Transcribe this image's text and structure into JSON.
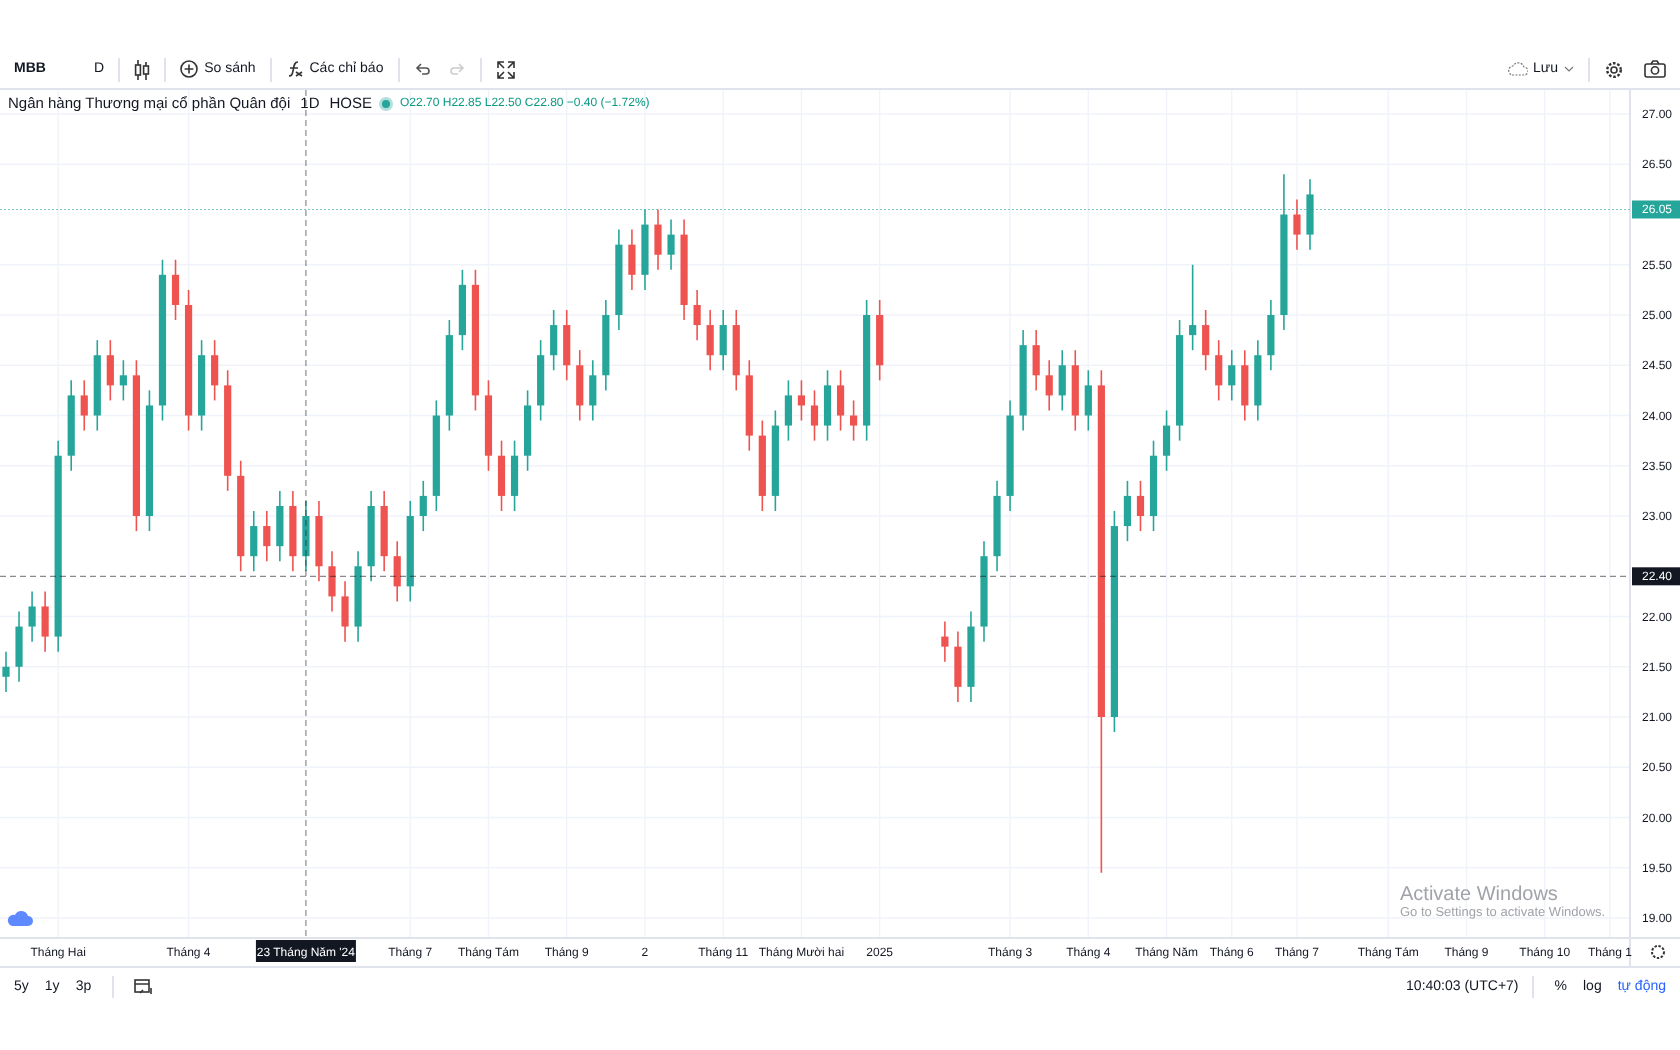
{
  "toolbar": {
    "symbol": "MBB",
    "interval": "D",
    "compare": "So sánh",
    "indicators": "Các chỉ báo",
    "save": "Lưu"
  },
  "legend": {
    "name": "Ngân hàng Thương mại cổ phần Quân đội",
    "interval": "1D",
    "exchange": "HOSE",
    "ohlc": "O22.70 H22.85 L22.50 C22.80 −0.40 (−1.72%)"
  },
  "chart_data": {
    "type": "candlestick",
    "grid": true,
    "ylim": [
      18.801,
      27.239
    ],
    "yticks": [
      {
        "value": 19,
        "label": "19.00"
      },
      {
        "value": 19.5,
        "label": "19.50"
      },
      {
        "value": 20,
        "label": "20.00"
      },
      {
        "value": 20.5,
        "label": "20.50"
      },
      {
        "value": 21,
        "label": "21.00"
      },
      {
        "value": 21.5,
        "label": "21.50"
      },
      {
        "value": 22,
        "label": "22.00"
      },
      {
        "value": 23,
        "label": "23.00"
      },
      {
        "value": 23.5,
        "label": "23.50"
      },
      {
        "value": 24,
        "label": "24.00"
      },
      {
        "value": 24.5,
        "label": "24.50"
      },
      {
        "value": 25,
        "label": "25.00"
      },
      {
        "value": 25.5,
        "label": "25.50"
      },
      {
        "value": 26.5,
        "label": "26.50"
      },
      {
        "value": 27,
        "label": "27.00"
      }
    ],
    "categories": [
      null,
      null,
      null,
      null,
      "Tháng Hai",
      null,
      null,
      null,
      null,
      null,
      null,
      null,
      null,
      null,
      "Tháng 4",
      null,
      null,
      null,
      null,
      null,
      null,
      null,
      null,
      null,
      null,
      null,
      null,
      null,
      null,
      null,
      null,
      "Tháng 7",
      null,
      null,
      null,
      null,
      null,
      "Tháng Tám",
      null,
      null,
      null,
      null,
      null,
      "Tháng 9",
      null,
      null,
      null,
      null,
      null,
      "2",
      null,
      null,
      null,
      null,
      null,
      "Tháng 11",
      null,
      null,
      null,
      null,
      null,
      "Tháng Mười hai",
      null,
      null,
      null,
      null,
      null,
      "2025",
      null,
      null,
      null,
      null,
      null,
      null,
      null,
      null,
      null,
      "Tháng 3",
      null,
      null,
      null,
      null,
      null,
      "Tháng 4",
      null,
      null,
      null,
      null,
      null,
      "Tháng Năm",
      null,
      null,
      null,
      null,
      "Tháng 6",
      null,
      null,
      null,
      null,
      "Tháng 7",
      null,
      null,
      null,
      null,
      null,
      null,
      "Tháng Tám",
      null,
      null,
      null,
      null,
      null,
      "Tháng 9",
      null,
      null,
      null,
      null,
      null,
      "Tháng 10",
      null,
      null,
      null,
      null,
      "Tháng 1",
      null,
      null
    ],
    "ohlc": [
      [
        21.4,
        21.65,
        21.25,
        21.5
      ],
      [
        21.5,
        22.05,
        21.35,
        21.9
      ],
      [
        21.9,
        22.25,
        21.75,
        22.1
      ],
      [
        22.1,
        22.25,
        21.65,
        21.8
      ],
      [
        21.8,
        23.75,
        21.65,
        23.6
      ],
      [
        23.6,
        24.35,
        23.45,
        24.2
      ],
      [
        24.2,
        24.35,
        23.85,
        24.0
      ],
      [
        24.0,
        24.75,
        23.85,
        24.6
      ],
      [
        24.6,
        24.75,
        24.15,
        24.3
      ],
      [
        24.3,
        24.55,
        24.15,
        24.4
      ],
      [
        24.4,
        24.55,
        22.85,
        23.0
      ],
      [
        23.0,
        24.25,
        22.85,
        24.1
      ],
      [
        24.1,
        25.55,
        23.95,
        25.4
      ],
      [
        25.4,
        25.55,
        24.95,
        25.1
      ],
      [
        25.1,
        25.25,
        23.85,
        24.0
      ],
      [
        24.0,
        24.75,
        23.85,
        24.6
      ],
      [
        24.6,
        24.75,
        24.15,
        24.3
      ],
      [
        24.3,
        24.45,
        23.25,
        23.4
      ],
      [
        23.4,
        23.55,
        22.45,
        22.6
      ],
      [
        22.6,
        23.05,
        22.45,
        22.9
      ],
      [
        22.9,
        23.05,
        22.55,
        22.7
      ],
      [
        22.7,
        23.25,
        22.55,
        23.1
      ],
      [
        23.1,
        23.25,
        22.45,
        22.6
      ],
      [
        22.6,
        23.15,
        22.45,
        23.0
      ],
      [
        23.0,
        23.15,
        22.35,
        22.5
      ],
      [
        22.5,
        22.65,
        22.05,
        22.2
      ],
      [
        22.2,
        22.35,
        21.75,
        21.9
      ],
      [
        21.9,
        22.65,
        21.75,
        22.5
      ],
      [
        22.5,
        23.25,
        22.35,
        23.1
      ],
      [
        23.1,
        23.25,
        22.45,
        22.6
      ],
      [
        22.6,
        22.75,
        22.15,
        22.3
      ],
      [
        22.3,
        23.15,
        22.15,
        23.0
      ],
      [
        23.0,
        23.35,
        22.85,
        23.2
      ],
      [
        23.2,
        24.15,
        23.05,
        24.0
      ],
      [
        24.0,
        24.95,
        23.85,
        24.8
      ],
      [
        24.8,
        25.45,
        24.65,
        25.3
      ],
      [
        25.3,
        25.45,
        24.05,
        24.2
      ],
      [
        24.2,
        24.35,
        23.45,
        23.6
      ],
      [
        23.6,
        23.75,
        23.05,
        23.2
      ],
      [
        23.2,
        23.75,
        23.05,
        23.6
      ],
      [
        23.6,
        24.25,
        23.45,
        24.1
      ],
      [
        24.1,
        24.75,
        23.95,
        24.6
      ],
      [
        24.6,
        25.05,
        24.45,
        24.9
      ],
      [
        24.9,
        25.05,
        24.35,
        24.5
      ],
      [
        24.5,
        24.65,
        23.95,
        24.1
      ],
      [
        24.1,
        24.55,
        23.95,
        24.4
      ],
      [
        24.4,
        25.15,
        24.25,
        25.0
      ],
      [
        25.0,
        25.85,
        24.85,
        25.7
      ],
      [
        25.7,
        25.85,
        25.25,
        25.4
      ],
      [
        25.4,
        26.05,
        25.25,
        25.9
      ],
      [
        25.9,
        26.05,
        25.45,
        25.6
      ],
      [
        25.6,
        25.95,
        25.45,
        25.8
      ],
      [
        25.8,
        25.95,
        24.95,
        25.1
      ],
      [
        25.1,
        25.25,
        24.75,
        24.9
      ],
      [
        24.9,
        25.05,
        24.45,
        24.6
      ],
      [
        24.6,
        25.05,
        24.45,
        24.9
      ],
      [
        24.9,
        25.05,
        24.25,
        24.4
      ],
      [
        24.4,
        24.55,
        23.65,
        23.8
      ],
      [
        23.8,
        23.95,
        23.05,
        23.2
      ],
      [
        23.2,
        24.05,
        23.05,
        23.9
      ],
      [
        23.9,
        24.35,
        23.75,
        24.2
      ],
      [
        24.2,
        24.35,
        23.95,
        24.1
      ],
      [
        24.1,
        24.25,
        23.75,
        23.9
      ],
      [
        23.9,
        24.45,
        23.75,
        24.3
      ],
      [
        24.3,
        24.45,
        23.85,
        24.0
      ],
      [
        24.0,
        24.15,
        23.75,
        23.9
      ],
      [
        23.9,
        25.15,
        23.75,
        25.0
      ],
      [
        25.0,
        25.15,
        24.35,
        24.5
      ],
      null,
      null,
      null,
      null,
      [
        21.8,
        21.95,
        21.55,
        21.7
      ],
      [
        21.7,
        21.85,
        21.15,
        21.3
      ],
      [
        21.3,
        22.05,
        21.15,
        21.9
      ],
      [
        21.9,
        22.75,
        21.75,
        22.6
      ],
      [
        22.6,
        23.35,
        22.45,
        23.2
      ],
      [
        23.2,
        24.15,
        23.05,
        24.0
      ],
      [
        24.0,
        24.85,
        23.85,
        24.7
      ],
      [
        24.7,
        24.85,
        24.25,
        24.4
      ],
      [
        24.4,
        24.55,
        24.05,
        24.2
      ],
      [
        24.2,
        24.65,
        24.05,
        24.5
      ],
      [
        24.5,
        24.65,
        23.85,
        24.0
      ],
      [
        24.0,
        24.45,
        23.85,
        24.3
      ],
      [
        24.3,
        24.45,
        19.45,
        21.0
      ],
      [
        21.0,
        23.05,
        20.85,
        22.9
      ],
      [
        22.9,
        23.35,
        22.75,
        23.2
      ],
      [
        23.2,
        23.35,
        22.85,
        23.0
      ],
      [
        23.0,
        23.75,
        22.85,
        23.6
      ],
      [
        23.6,
        24.05,
        23.45,
        23.9
      ],
      [
        23.9,
        24.95,
        23.75,
        24.8
      ],
      [
        24.8,
        25.5,
        24.65,
        24.9
      ],
      [
        24.9,
        25.05,
        24.45,
        24.6
      ],
      [
        24.6,
        24.75,
        24.15,
        24.3
      ],
      [
        24.3,
        24.65,
        24.15,
        24.5
      ],
      [
        24.5,
        24.65,
        23.95,
        24.1
      ],
      [
        24.1,
        24.75,
        23.95,
        24.6
      ],
      [
        24.6,
        25.15,
        24.45,
        25.0
      ],
      [
        25.0,
        26.4,
        24.85,
        26.0
      ],
      [
        26.0,
        26.15,
        25.65,
        25.8
      ],
      [
        25.8,
        26.35,
        25.65,
        26.2
      ],
      null,
      null,
      null,
      null,
      null,
      null,
      null,
      null,
      null,
      null,
      null,
      null,
      null,
      null,
      null,
      null,
      null,
      null,
      null,
      null,
      null,
      null,
      null,
      null,
      null
    ],
    "ref_lines": [
      {
        "axis": "y",
        "value": 26.05,
        "label": "26.05",
        "color": "#26a69a"
      },
      {
        "axis": "y",
        "value": 22.4,
        "label": "22.40",
        "color": "#131722"
      }
    ]
  },
  "crosshair": {
    "date": "23 Tháng Năm '24"
  },
  "watermark": {
    "title": "Activate Windows",
    "text": "Go to Settings to activate Windows."
  },
  "ranges": [
    {
      "label": "5y"
    },
    {
      "label": "1y"
    },
    {
      "label": "3p"
    }
  ],
  "status": {
    "time": "10:40:03 (UTC+7)",
    "percent": "%",
    "log": "log",
    "auto": "tự động"
  }
}
